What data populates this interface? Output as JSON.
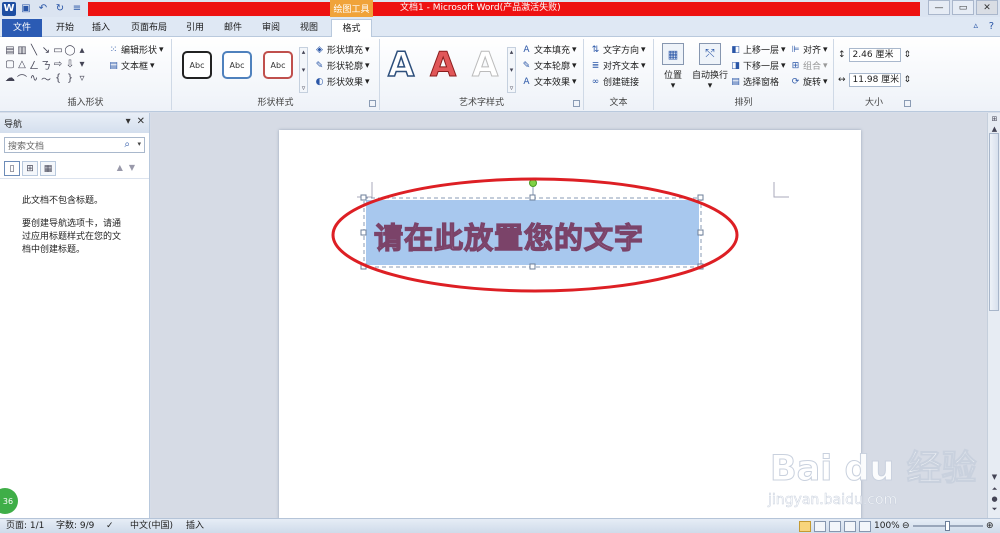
{
  "window": {
    "title": "文档1 - Microsoft Word(产品激活失败)",
    "contextual_tab_group": "绘图工具",
    "app_icon": "W"
  },
  "quick_access": [
    "save-icon",
    "undo-icon",
    "redo-icon",
    "customize-icon"
  ],
  "window_controls": {
    "minimize": "—",
    "maximize": "▭",
    "close": "✕"
  },
  "tabs": [
    {
      "label": "文件"
    },
    {
      "label": "开始"
    },
    {
      "label": "插入"
    },
    {
      "label": "页面布局"
    },
    {
      "label": "引用"
    },
    {
      "label": "邮件"
    },
    {
      "label": "审阅"
    },
    {
      "label": "视图"
    },
    {
      "label": "格式"
    }
  ],
  "ribbon": {
    "insert_shapes": {
      "label": "插入形状",
      "edit_shape": "编辑形状",
      "text_box": "文本框"
    },
    "shape_styles": {
      "label": "形状样式",
      "presets": [
        "Abc",
        "Abc",
        "Abc"
      ],
      "fill": "形状填充",
      "outline": "形状轮廓",
      "effects": "形状效果"
    },
    "wordart_styles": {
      "label": "艺术字样式",
      "samples": [
        "A",
        "A",
        "A"
      ],
      "text_fill": "文本填充",
      "text_outline": "文本轮廓",
      "text_effects": "文本效果"
    },
    "text": {
      "label": "文本",
      "direction": "文字方向",
      "align": "对齐文本",
      "link": "创建链接"
    },
    "arrange": {
      "label": "排列",
      "position": "位置",
      "wrap": "自动换行",
      "bring_forward": "上移一层",
      "send_backward": "下移一层",
      "selection_pane": "选择窗格",
      "align": "对齐",
      "group": "组合",
      "rotate": "旋转"
    },
    "size": {
      "label": "大小",
      "height": "2.46 厘米",
      "width": "11.98 厘米"
    }
  },
  "nav": {
    "title": "导航",
    "search_placeholder": "搜索文档",
    "no_headings": "此文档不包含标题。",
    "hint": "要创建导航选项卡，请通过应用标题样式在您的文档中创建标题。"
  },
  "document": {
    "textbox_text": "请在此放置您的文字"
  },
  "status": {
    "page": "页面: 1/1",
    "words": "字数: 9/9",
    "language": "中文(中国)",
    "mode": "插入",
    "zoom": "100%"
  },
  "watermark": {
    "brand": "Bai du 经验",
    "url": "jingyan.baidu.com"
  },
  "colors": {
    "title_red": "#ee1111",
    "contextual_orange": "#f0a33a",
    "file_tab_blue": "#2b5bb4",
    "annotation_red": "#dd1f24",
    "selection_blue": "#a8c8ee",
    "wordart_fill": "#c5a9d1",
    "wordart_outline": "#7b4369"
  },
  "page_badge": "36"
}
